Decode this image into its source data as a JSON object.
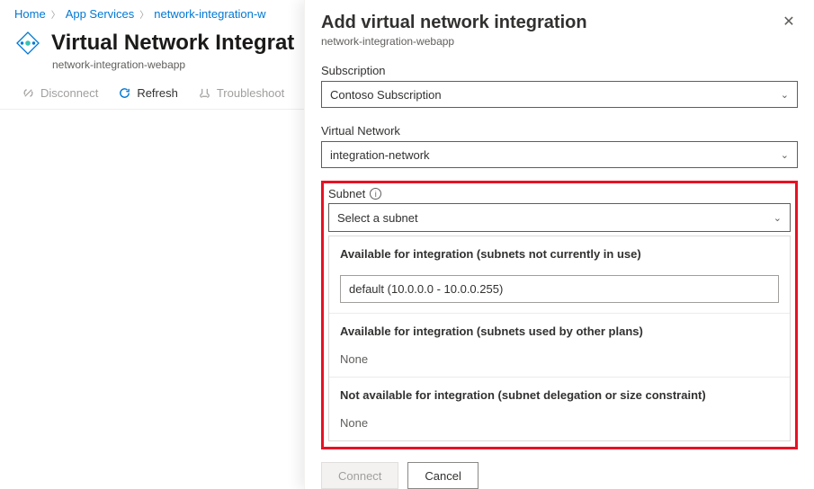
{
  "breadcrumb": {
    "home": "Home",
    "appServices": "App Services",
    "resource": "network-integration-w"
  },
  "page": {
    "title": "Virtual Network Integrat",
    "subtitle": "network-integration-webapp"
  },
  "toolbar": {
    "disconnect": "Disconnect",
    "refresh": "Refresh",
    "troubleshoot": "Troubleshoot"
  },
  "panel": {
    "title": "Add virtual network integration",
    "subtitle": "network-integration-webapp",
    "fields": {
      "subscription_label": "Subscription",
      "subscription_value": "Contoso Subscription",
      "vnet_label": "Virtual Network",
      "vnet_value": "integration-network",
      "subnet_label": "Subnet",
      "subnet_placeholder": "Select a subnet"
    },
    "subnet_groups": {
      "group1_title": "Available for integration (subnets not currently in use)",
      "group1_item": "default (10.0.0.0 - 10.0.0.255)",
      "group2_title": "Available for integration (subnets used by other plans)",
      "group2_none": "None",
      "group3_title": "Not available for integration (subnet delegation or size constraint)",
      "group3_none": "None"
    },
    "buttons": {
      "connect": "Connect",
      "cancel": "Cancel"
    }
  }
}
